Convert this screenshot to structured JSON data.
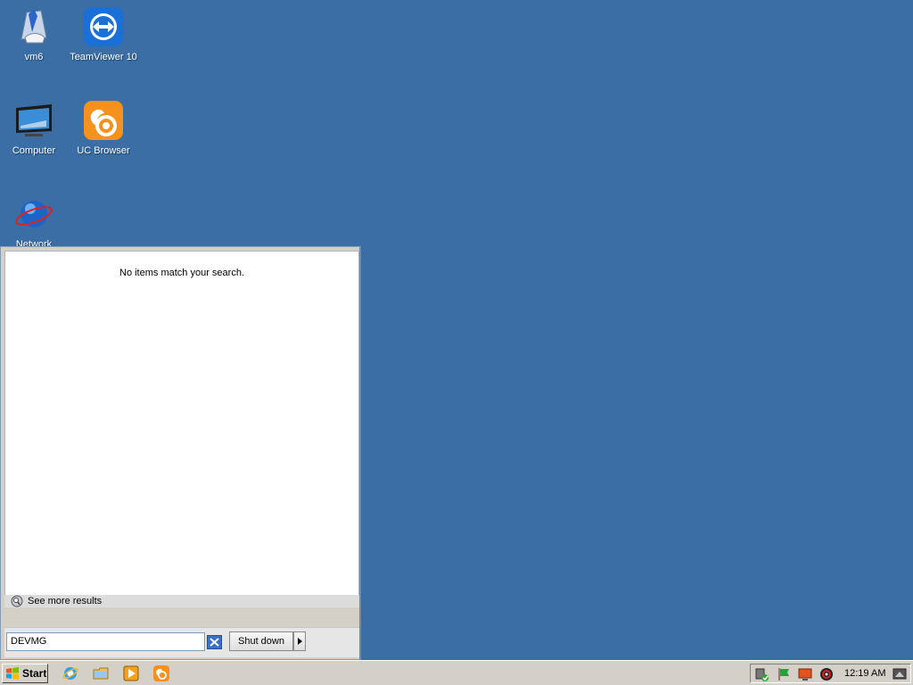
{
  "desktop": {
    "icons": [
      {
        "label": "vm6",
        "icon": "vm6-icon"
      },
      {
        "label": "TeamViewer 10",
        "icon": "teamviewer-icon"
      },
      {
        "label": "Computer",
        "icon": "computer-icon"
      },
      {
        "label": "UC Browser",
        "icon": "uc-browser-icon"
      },
      {
        "label": "Network",
        "icon": "network-icon"
      }
    ],
    "background_color": "#3a6ea5"
  },
  "start_menu": {
    "no_results_text": "No items match your search.",
    "see_more_label": "See more results",
    "search_value": "DEVMG",
    "shutdown_label": "Shut down"
  },
  "taskbar": {
    "start_label": "Start",
    "quick_launch": [
      "internet-explorer-icon",
      "windows-explorer-icon",
      "media-player-icon",
      "uc-browser-icon"
    ],
    "tray_icons": [
      "network-connection-icon",
      "flag-icon",
      "display-icon",
      "audio-icon"
    ],
    "clock": "12:19 AM"
  }
}
